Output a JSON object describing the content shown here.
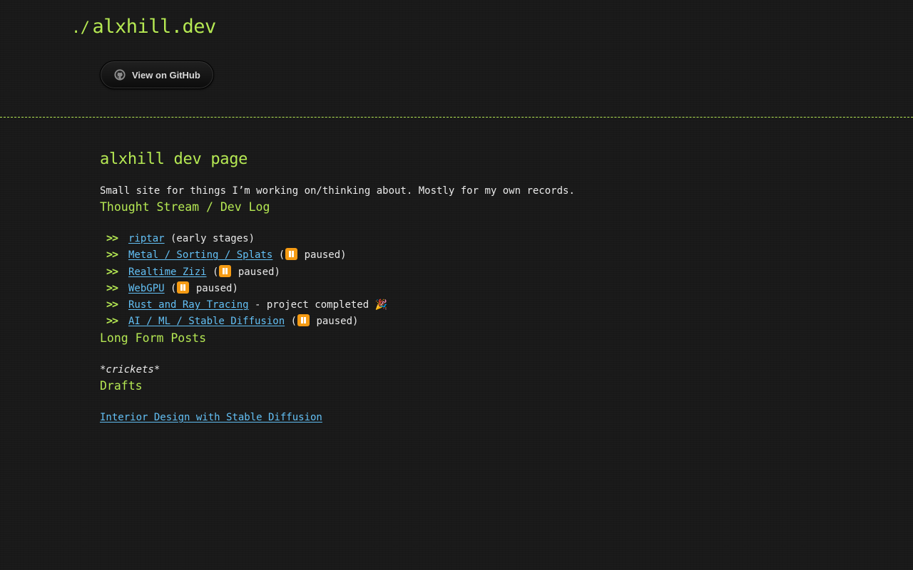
{
  "header": {
    "title_prefix": "./",
    "title": "alxhill.dev",
    "github_button_label": "View on GitHub",
    "accent_color": "#b5e853"
  },
  "main": {
    "page_title": "alxhill dev page",
    "intro": "Small site for things I’m working on/thinking about. Mostly for my own records.",
    "thought_stream": {
      "heading": "Thought Stream / Dev Log",
      "bullet": ">>",
      "items": [
        {
          "link": "riptar",
          "note": " (early stages)"
        },
        {
          "link": "Metal / Sorting / Splats",
          "status": "paused"
        },
        {
          "link": "Realtime Zizi",
          "status": "paused"
        },
        {
          "link": "WebGPU",
          "status": "paused"
        },
        {
          "link": "Rust and Ray Tracing",
          "note": " - project completed 🎉"
        },
        {
          "link": "AI / ML / Stable Diffusion",
          "status": "paused"
        }
      ]
    },
    "long_form": {
      "heading": "Long Form Posts",
      "content": "*crickets*"
    },
    "drafts": {
      "heading": "Drafts",
      "items": [
        "Interior Design with Stable Diffusion"
      ]
    }
  },
  "icons": {
    "github": "github-icon",
    "pause": "pause-button-icon",
    "party": "party-popper-icon"
  },
  "colors": {
    "background": "#191919",
    "heading": "#b5e853",
    "link": "#63c0f5",
    "text": "#eaeaea",
    "pause_icon": "#f59b14"
  }
}
